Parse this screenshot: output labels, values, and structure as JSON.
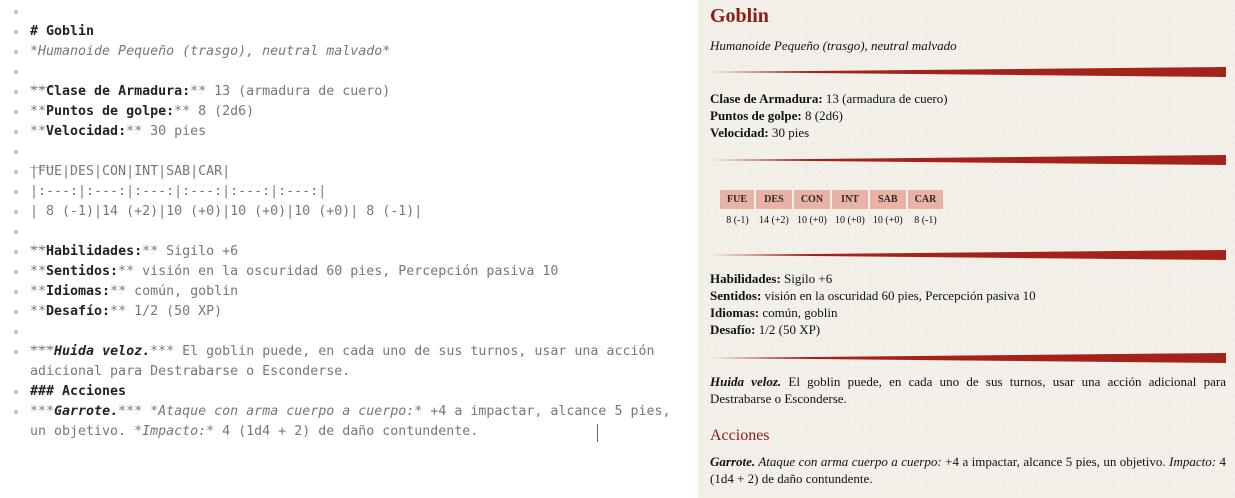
{
  "editor": {
    "title_line": "# Goblin",
    "subtitle_line": "*Humanoide Pequeño (trasgo), neutral malvado*",
    "hr": "___",
    "ac": {
      "pre": "**",
      "label": "Clase de Armadura:",
      "post": "**",
      "value": " 13 (armadura de cuero)"
    },
    "hp": {
      "pre": "**",
      "label": "Puntos de golpe:",
      "post": "**",
      "value": " 8 (2d6)"
    },
    "speed": {
      "pre": "**",
      "label": "Velocidad:",
      "post": "**",
      "value": " 30 pies"
    },
    "table_header": "|FUE|DES|CON|INT|SAB|CAR|",
    "table_align": "|:---:|:---:|:---:|:---:|:---:|:---:|",
    "table_values": "| 8 (-1)|14 (+2)|10 (+0)|10 (+0)|10 (+0)| 8 (-1)|",
    "skills": {
      "pre": "**",
      "label": "Habilidades:",
      "post": "**",
      "value": " Sigilo +6"
    },
    "senses": {
      "pre": "**",
      "label": "Sentidos:",
      "post": "**",
      "value": " visión en la oscuridad 60 pies, Percepción pasiva 10"
    },
    "languages": {
      "pre": "**",
      "label": "Idiomas:",
      "post": "**",
      "value": " común, goblin"
    },
    "challenge": {
      "pre": "**",
      "label": "Desafío:",
      "post": "**",
      "value": " 1/2 (50 XP)"
    },
    "trait": {
      "pre": "***",
      "name": "Huida veloz.",
      "post": "***",
      "text": " El goblin puede, en cada uno de sus turnos, usar una acción adicional para Destrabarse o Esconderse."
    },
    "actions_line": "### Acciones",
    "action": {
      "pre": "***",
      "name": "Garrote.",
      "post": "***",
      "attack_md": " *Ataque con arma cuerpo a cuerpo:*",
      "attack_text": " +4 a impactar, alcance 5 pies, un objetivo. ",
      "hit_md": "*Impacto:*",
      "hit_text": " 4 (1d4 + 2) de daño contundente."
    }
  },
  "preview": {
    "title": "Goblin",
    "subtitle": "Humanoide Pequeño (trasgo), neutral malvado",
    "ac_label": "Clase de Armadura:",
    "ac_value": " 13 (armadura de cuero)",
    "hp_label": "Puntos de golpe:",
    "hp_value": " 8 (2d6)",
    "speed_label": "Velocidad:",
    "speed_value": " 30 pies",
    "abilities": {
      "headers": [
        "FUE",
        "DES",
        "CON",
        "INT",
        "SAB",
        "CAR"
      ],
      "values": [
        "8 (-1)",
        "14 (+2)",
        "10 (+0)",
        "10 (+0)",
        "10 (+0)",
        "8 (-1)"
      ]
    },
    "skills_label": "Habilidades:",
    "skills_value": " Sigilo +6",
    "senses_label": "Sentidos:",
    "senses_value": " visión en la oscuridad 60 pies, Percepción pasiva 10",
    "languages_label": "Idiomas:",
    "languages_value": " común, goblin",
    "challenge_label": "Desafío:",
    "challenge_value": " 1/2 (50 XP)",
    "trait_name": "Huida veloz.",
    "trait_text": " El goblin puede, en cada uno de sus turnos, usar una acción adicional para Destrabarse o Esconderse.",
    "actions_heading": "Acciones",
    "action_name": "Garrote.",
    "action_attack": " Ataque con arma cuerpo a cuerpo:",
    "action_text": " +4 a impactar, alcance 5 pies, un objetivo. ",
    "action_hit": "Impacto:",
    "action_damage": " 4 (1d4 + 2) de daño contundente."
  },
  "colors": {
    "accent": "#8c1c14",
    "rule": "#a3231b",
    "table_header_bg": "#e8b2a6",
    "parchment": "#f3f0ea"
  }
}
